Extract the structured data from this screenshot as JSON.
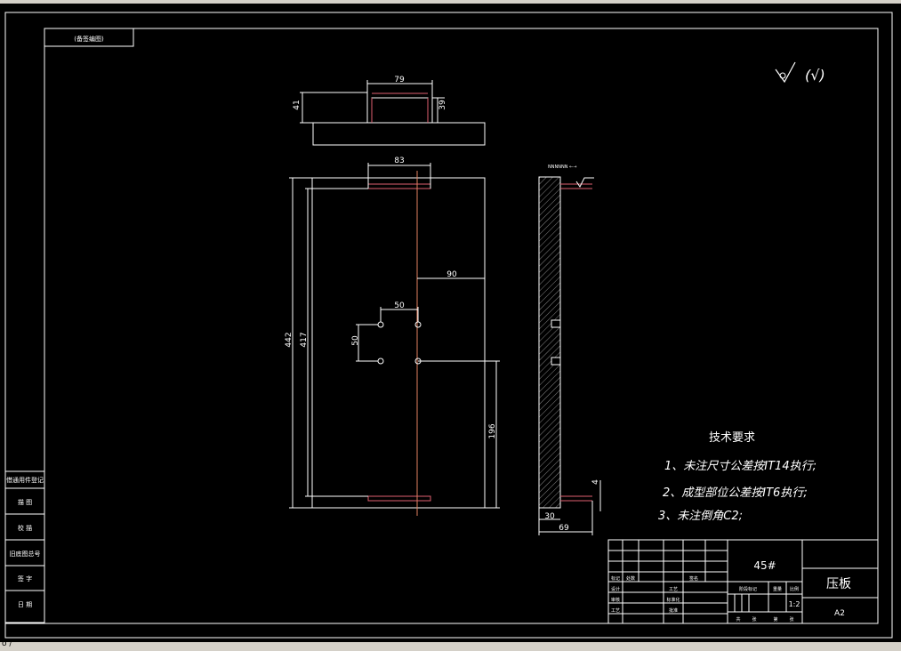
{
  "app": {
    "status_fragment": "o /"
  },
  "title_tag": "(备签编图)",
  "roughness": {
    "symbol": "∀",
    "paren_text": "(√)"
  },
  "views": {
    "top_dims": {
      "width": "79",
      "total_h": "41",
      "inner_h": "39"
    },
    "front_dims": {
      "top_w": "83",
      "right_off": "90",
      "hole_pitch_x": "50",
      "hole_pitch_y": "50",
      "total_h": "442",
      "inner_h": "417",
      "lower_h": "196"
    },
    "side_dims": {
      "note": "NNNNNN ←→",
      "thick": "30",
      "total_w": "69",
      "slot_h": "4"
    }
  },
  "tech_req": {
    "title": "技术要求",
    "items": [
      "1、未注尺寸公差按IT14执行;",
      "2、成型部位公差按IT6执行;",
      "3、未注倒角C2;"
    ]
  },
  "left_strip": [
    "借通用件登记",
    "描  图",
    "校  描",
    "旧底图总号",
    "签  字",
    "日  期"
  ],
  "title_block": {
    "material": "45#",
    "part_name": "压板",
    "scale": "1:2",
    "sheet_size": "A2",
    "col_labels": [
      "阶段标记",
      "重量",
      "比例"
    ],
    "bottom_labels": [
      "共",
      "张",
      "第",
      "张"
    ],
    "rev_header": [
      "标记",
      "处数",
      "分区",
      "更改文件号",
      "签名",
      "年月日"
    ],
    "sign_rows": [
      {
        "role": "设计",
        "mid": "标准化"
      },
      {
        "role": "审核",
        "mid": ""
      },
      {
        "role": "工艺",
        "mid": "批准"
      }
    ],
    "cols": [
      "工艺",
      "标准化",
      "批准"
    ]
  }
}
